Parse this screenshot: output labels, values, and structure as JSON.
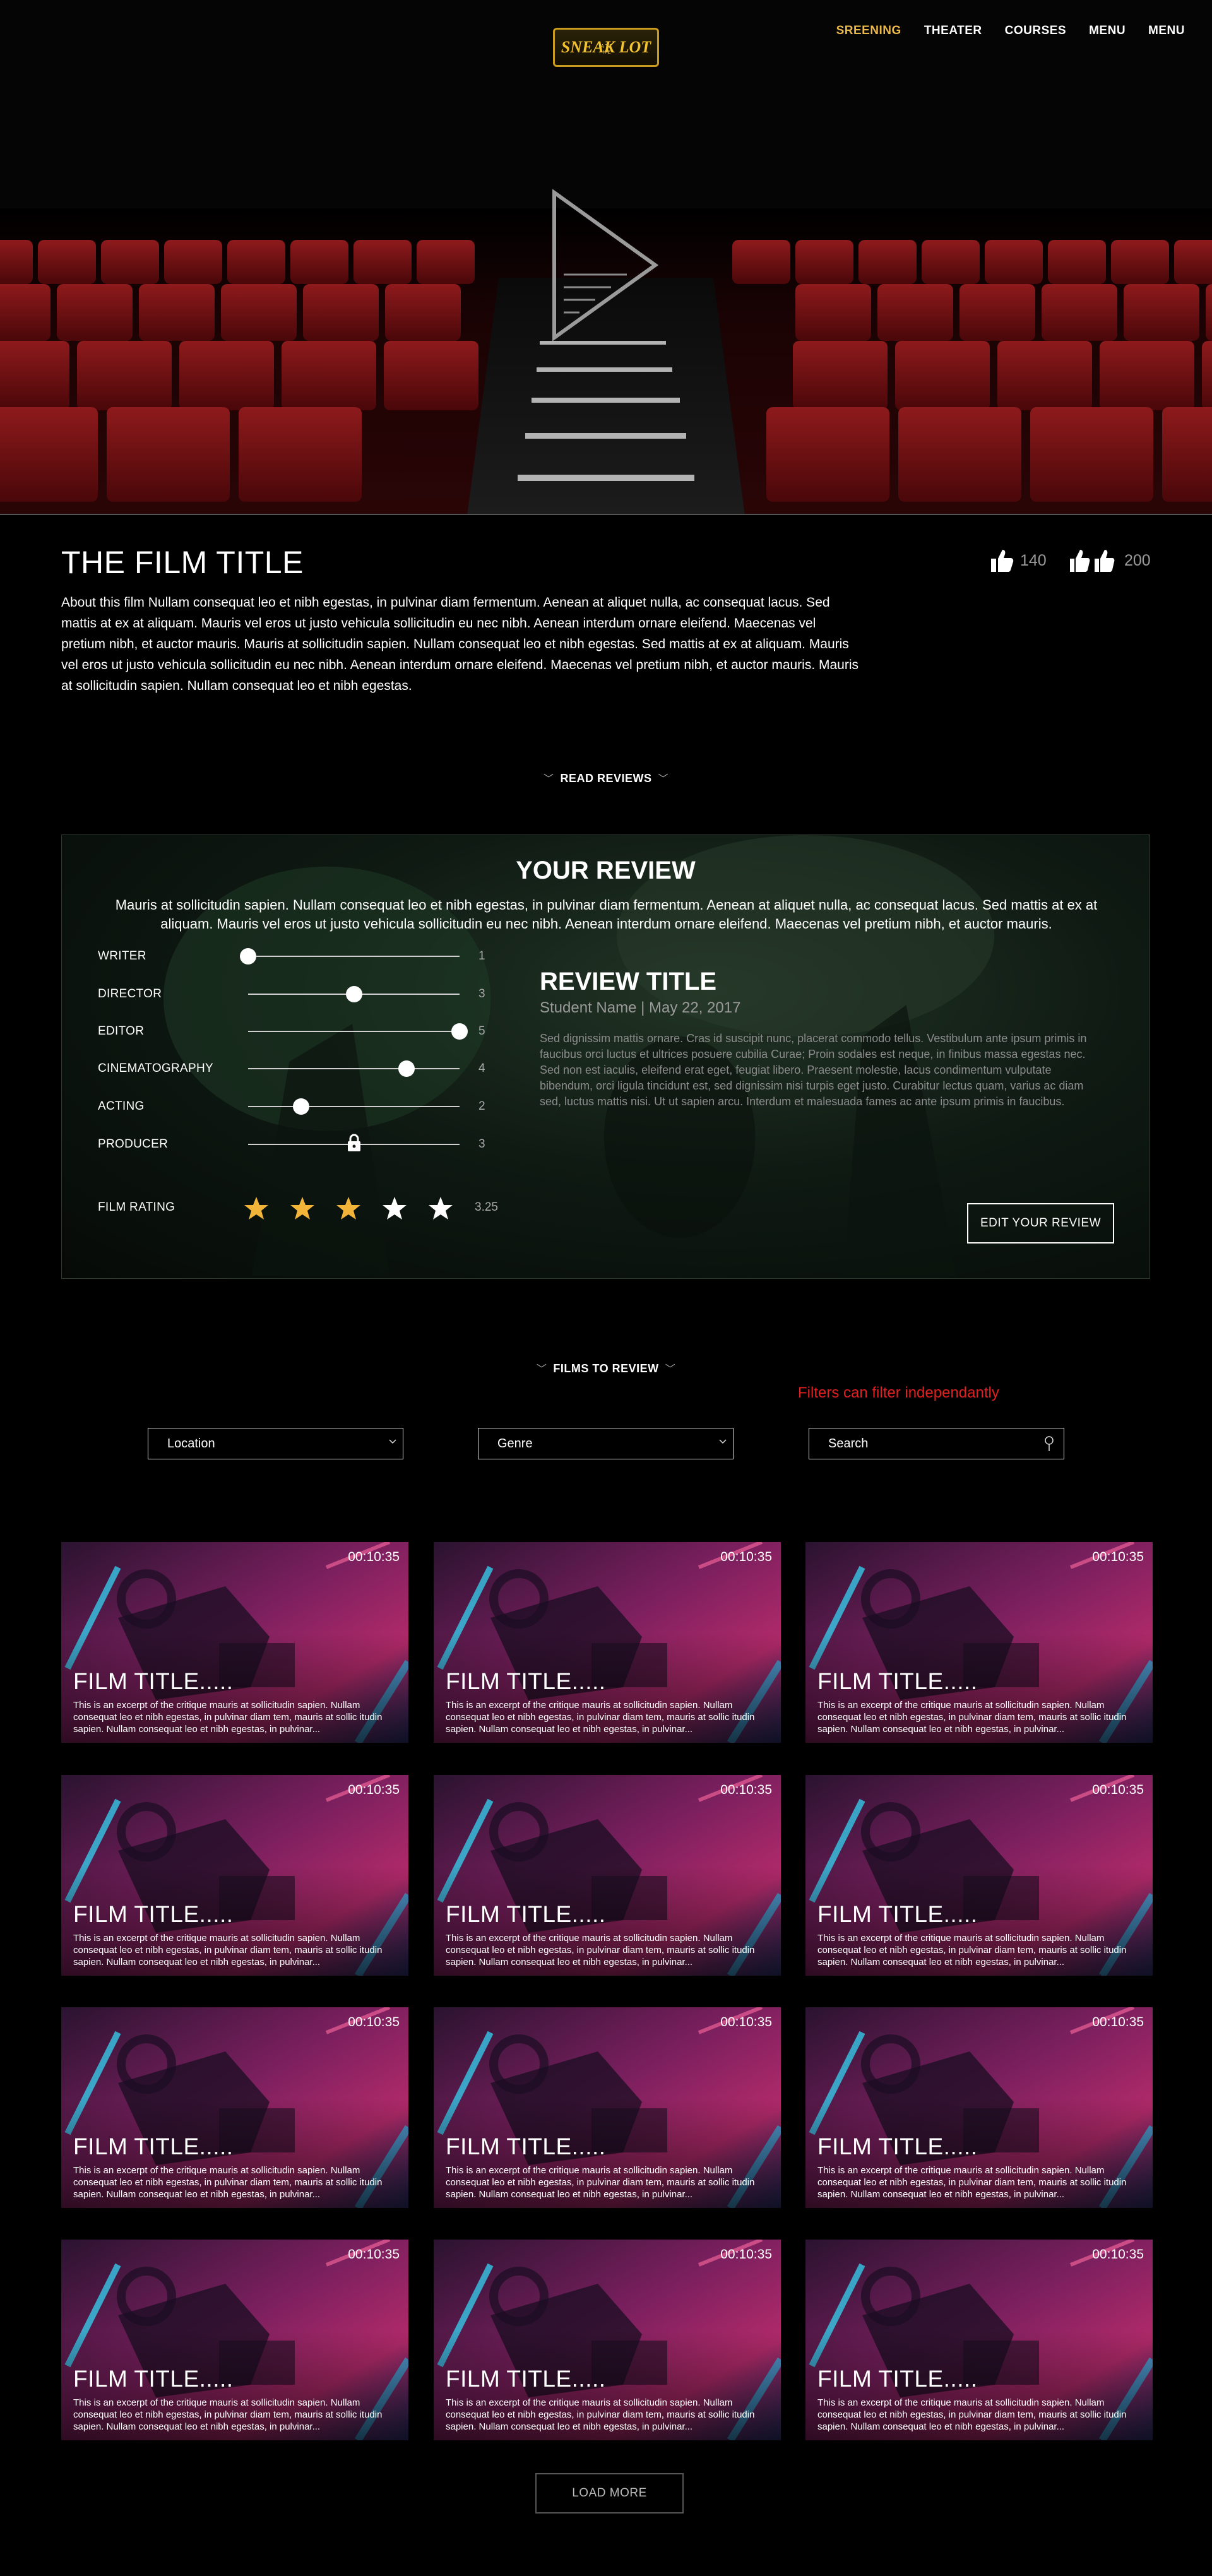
{
  "nav": {
    "logo_text": "SNEAK LOT",
    "logo_small": "A T T H E",
    "items": [
      {
        "label": "SREENING",
        "active": true
      },
      {
        "label": "THEATER",
        "active": false
      },
      {
        "label": "COURSES",
        "active": false
      },
      {
        "label": "MENU",
        "active": false
      },
      {
        "label": "MENU",
        "active": false
      }
    ]
  },
  "film": {
    "title": "THE FILM TITLE",
    "description": "About this film Nullam consequat leo et nibh egestas, in pulvinar diam fermentum. Aenean at aliquet nulla, ac consequat lacus. Sed mattis at ex at aliquam. Mauris vel eros ut justo vehicula sollicitudin eu nec nibh. Aenean interdum ornare eleifend. Maecenas vel pretium nibh, et auctor mauris. Mauris at sollicitudin sapien. Nullam consequat leo et nibh egestas. Sed mattis at ex at aliquam. Mauris vel eros ut justo vehicula sollicitudin eu nec nibh. Aenean interdum ornare eleifend. Maecenas vel pretium nibh, et auctor mauris. Mauris at sollicitudin sapien. Nullam consequat leo et nibh egestas.",
    "likes": 140,
    "double_likes": 200
  },
  "read_reviews_label": "READ REVIEWS",
  "your_review": {
    "heading": "YOUR REVIEW",
    "text": "Mauris at sollicitudin sapien. Nullam consequat leo et nibh egestas, in pulvinar diam fermentum. Aenean at aliquet nulla, ac consequat lacus. Sed mattis at ex at aliquam. Mauris vel eros ut justo vehicula sollicitudin eu nec nibh. Aenean interdum ornare eleifend. Maecenas vel pretium nibh, et auctor mauris.",
    "criteria": [
      {
        "label": "WRITER",
        "value": 1,
        "locked": false
      },
      {
        "label": "DIRECTOR",
        "value": 3,
        "locked": false
      },
      {
        "label": "EDITOR",
        "value": 5,
        "locked": false
      },
      {
        "label": "CINEMATOGRAPHY",
        "value": 4,
        "locked": false
      },
      {
        "label": "ACTING",
        "value": 2,
        "locked": false
      },
      {
        "label": "PRODUCER",
        "value": 3,
        "locked": true
      }
    ],
    "criteria_max": 5,
    "rating_label": "FILM RATING",
    "rating_value": "3.25",
    "stars_filled": 3,
    "stars_total": 5,
    "review_title": "REVIEW TITLE",
    "review_meta": "Student Name | May 22, 2017",
    "review_body": "Sed dignissim mattis ornare. Cras id suscipit nunc, placerat commodo tellus. Vestibulum ante ipsum primis in faucibus orci luctus et ultrices posuere cubilia Curae; Proin sodales est neque, in finibus massa egestas nec. Sed non est iaculis, eleifend erat eget, feugiat libero. Praesent molestie, lacus condimentum vulputate bibendum, orci ligula tincidunt est, sed dignissim nisi turpis eget justo. Curabitur lectus quam, varius ac diam sed, luctus mattis nisi. Ut ut sapien arcu. Interdum et malesuada fames ac ante ipsum primis in faucibus.",
    "edit_label": "EDIT YOUR REVIEW",
    "colors": {
      "star_filled": "#f3b43a",
      "star_empty": "#ffffff"
    }
  },
  "films_to_review_label": "FILMS TO REVIEW",
  "filters": {
    "note": "Filters can filter independantly",
    "location": "Location",
    "genre": "Genre",
    "search_placeholder": "Search"
  },
  "films": [
    {
      "title": "FILM TITLE.....",
      "duration": "00:10:35",
      "excerpt": "This is an excerpt of the critique mauris at sollicitudin sapien. Nullam consequat leo et nibh egestas, in pulvinar diam tem, mauris at sollic itudin sapien. Nullam consequat leo et nibh egestas, in pulvinar..."
    },
    {
      "title": "FILM TITLE.....",
      "duration": "00:10:35",
      "excerpt": "This is an excerpt of the critique mauris at sollicitudin sapien. Nullam consequat leo et nibh egestas, in pulvinar diam tem, mauris at sollic itudin sapien. Nullam consequat leo et nibh egestas, in pulvinar..."
    },
    {
      "title": "FILM TITLE.....",
      "duration": "00:10:35",
      "excerpt": "This is an excerpt of the critique mauris at sollicitudin sapien. Nullam consequat leo et nibh egestas, in pulvinar diam tem, mauris at sollic itudin sapien. Nullam consequat leo et nibh egestas, in pulvinar..."
    },
    {
      "title": "FILM TITLE.....",
      "duration": "00:10:35",
      "excerpt": "This is an excerpt of the critique mauris at sollicitudin sapien. Nullam consequat leo et nibh egestas, in pulvinar diam tem, mauris at sollic itudin sapien. Nullam consequat leo et nibh egestas, in pulvinar..."
    },
    {
      "title": "FILM TITLE.....",
      "duration": "00:10:35",
      "excerpt": "This is an excerpt of the critique mauris at sollicitudin sapien. Nullam consequat leo et nibh egestas, in pulvinar diam tem, mauris at sollic itudin sapien. Nullam consequat leo et nibh egestas, in pulvinar..."
    },
    {
      "title": "FILM TITLE.....",
      "duration": "00:10:35",
      "excerpt": "This is an excerpt of the critique mauris at sollicitudin sapien. Nullam consequat leo et nibh egestas, in pulvinar diam tem, mauris at sollic itudin sapien. Nullam consequat leo et nibh egestas, in pulvinar..."
    },
    {
      "title": "FILM TITLE.....",
      "duration": "00:10:35",
      "excerpt": "This is an excerpt of the critique mauris at sollicitudin sapien. Nullam consequat leo et nibh egestas, in pulvinar diam tem, mauris at sollic itudin sapien. Nullam consequat leo et nibh egestas, in pulvinar..."
    },
    {
      "title": "FILM TITLE.....",
      "duration": "00:10:35",
      "excerpt": "This is an excerpt of the critique mauris at sollicitudin sapien. Nullam consequat leo et nibh egestas, in pulvinar diam tem, mauris at sollic itudin sapien. Nullam consequat leo et nibh egestas, in pulvinar..."
    },
    {
      "title": "FILM TITLE.....",
      "duration": "00:10:35",
      "excerpt": "This is an excerpt of the critique mauris at sollicitudin sapien. Nullam consequat leo et nibh egestas, in pulvinar diam tem, mauris at sollic itudin sapien. Nullam consequat leo et nibh egestas, in pulvinar..."
    },
    {
      "title": "FILM TITLE.....",
      "duration": "00:10:35",
      "excerpt": "This is an excerpt of the critique mauris at sollicitudin sapien. Nullam consequat leo et nibh egestas, in pulvinar diam tem, mauris at sollic itudin sapien. Nullam consequat leo et nibh egestas, in pulvinar..."
    },
    {
      "title": "FILM TITLE.....",
      "duration": "00:10:35",
      "excerpt": "This is an excerpt of the critique mauris at sollicitudin sapien. Nullam consequat leo et nibh egestas, in pulvinar diam tem, mauris at sollic itudin sapien. Nullam consequat leo et nibh egestas, in pulvinar..."
    },
    {
      "title": "FILM TITLE.....",
      "duration": "00:10:35",
      "excerpt": "This is an excerpt of the critique mauris at sollicitudin sapien. Nullam consequat leo et nibh egestas, in pulvinar diam tem, mauris at sollic itudin sapien. Nullam consequat leo et nibh egestas, in pulvinar..."
    }
  ],
  "load_more": "LOAD MORE",
  "colors": {
    "accent": "#eab94a",
    "logo_gold": "#c99b1f",
    "note_red": "#e02020"
  }
}
